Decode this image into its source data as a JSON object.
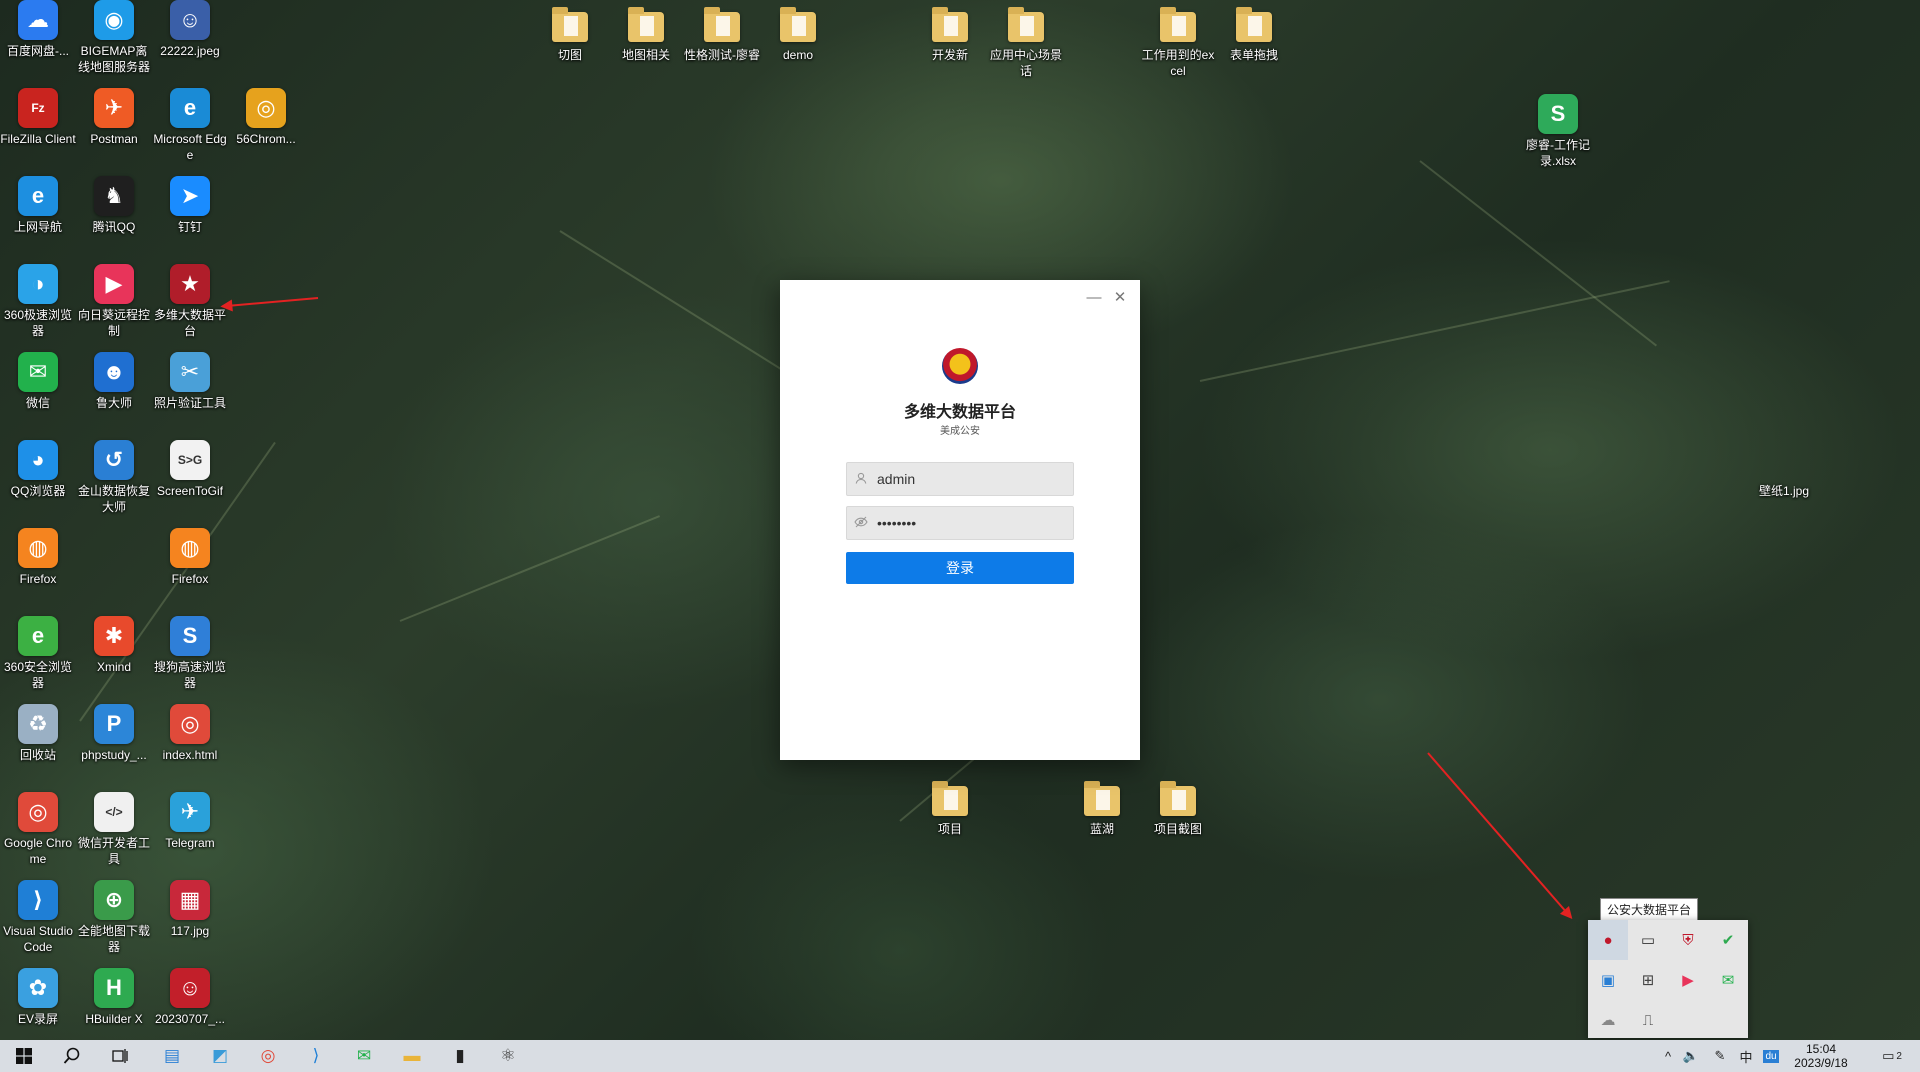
{
  "desktop": {
    "icons": [
      {
        "label": "百度网盘-...",
        "glyph": "☁",
        "color": "#2b7bf0"
      },
      {
        "label": "BIGEMAP离线地图服务器",
        "glyph": "◉",
        "color": "#1e9be8"
      },
      {
        "label": "22222.jpeg",
        "glyph": "☺",
        "color": "#3a5fa8"
      },
      {
        "label": "FileZilla Client",
        "glyph": "Fz",
        "color": "#c9241f"
      },
      {
        "label": "Postman",
        "glyph": "✈",
        "color": "#ef5b25"
      },
      {
        "label": "Microsoft Edge",
        "glyph": "e",
        "color": "#1a8bd6"
      },
      {
        "label": "56Chrom...",
        "glyph": "◎",
        "color": "#e6a21d"
      },
      {
        "label": "上网导航",
        "glyph": "e",
        "color": "#1d8fe0"
      },
      {
        "label": "腾讯QQ",
        "glyph": "♞",
        "color": "#1f1f1f"
      },
      {
        "label": "钉钉",
        "glyph": "➤",
        "color": "#1a8cff"
      },
      {
        "label": "360极速浏览器",
        "glyph": "◑",
        "color": "#2aa3e8"
      },
      {
        "label": "向日葵远程控制",
        "glyph": "▶",
        "color": "#e8345a"
      },
      {
        "label": "多维大数据平台",
        "glyph": "★",
        "color": "#b01d2a"
      },
      {
        "label": "微信",
        "glyph": "✉",
        "color": "#22b14c"
      },
      {
        "label": "鲁大师",
        "glyph": "☻",
        "color": "#1f6fd1"
      },
      {
        "label": "照片验证工具",
        "glyph": "✂",
        "color": "#4aa0d8"
      },
      {
        "label": "QQ浏览器",
        "glyph": "◕",
        "color": "#1e90e8"
      },
      {
        "label": "金山数据恢复大师",
        "glyph": "↺",
        "color": "#2a7fd4"
      },
      {
        "label": "ScreenToGif",
        "glyph": "S>G",
        "color": "#f2f2f2"
      },
      {
        "label": "Firefox",
        "glyph": "◍",
        "color": "#f5841f"
      },
      {
        "label": "Firefox",
        "glyph": "◍",
        "color": "#f5841f"
      },
      {
        "label": "360安全浏览器",
        "glyph": "e",
        "color": "#3cb043"
      },
      {
        "label": "Xmind",
        "glyph": "✱",
        "color": "#e84a2c"
      },
      {
        "label": "搜狗高速浏览器",
        "glyph": "S",
        "color": "#2f7fd8"
      },
      {
        "label": "回收站",
        "glyph": "♻",
        "color": "#9ab0c4"
      },
      {
        "label": "phpstudy_...",
        "glyph": "P",
        "color": "#2c86d8"
      },
      {
        "label": "index.html",
        "glyph": "◎",
        "color": "#e04a3a"
      },
      {
        "label": "Google Chrome",
        "glyph": "◎",
        "color": "#e04a3a"
      },
      {
        "label": "微信开发者工具",
        "glyph": "</>",
        "color": "#f0f0f0"
      },
      {
        "label": "Telegram",
        "glyph": "✈",
        "color": "#2aa1da"
      },
      {
        "label": "Visual Studio Code",
        "glyph": "⟩",
        "color": "#1f7fd6"
      },
      {
        "label": "全能地图下载器",
        "glyph": "⊕",
        "color": "#3a9b4a"
      },
      {
        "label": "117.jpg",
        "glyph": "▦",
        "color": "#c8283a"
      },
      {
        "label": "EV录屏",
        "glyph": "✿",
        "color": "#3aa0e0"
      },
      {
        "label": "HBuilder X",
        "glyph": "H",
        "color": "#2eaa50"
      },
      {
        "label": "20230707_...",
        "glyph": "☺",
        "color": "#c21f2a"
      }
    ],
    "folders": [
      {
        "label": "切图"
      },
      {
        "label": "地图相关"
      },
      {
        "label": "性格测试-廖睿"
      },
      {
        "label": "demo"
      },
      {
        "label": "开发新"
      },
      {
        "label": "应用中心场景话"
      },
      {
        "label": "工作用到的excel"
      },
      {
        "label": "表单拖拽"
      },
      {
        "label": "项目"
      },
      {
        "label": "蓝湖"
      },
      {
        "label": "项目截图"
      }
    ],
    "files": [
      {
        "label": "廖睿-工作记录.xlsx",
        "glyph": "S",
        "color": "#2eaa5a"
      },
      {
        "label": "壁纸1.jpg",
        "glyph": "",
        "color": "transparent"
      }
    ]
  },
  "login": {
    "minimize": "—",
    "close": "✕",
    "title": "多维大数据平台",
    "subtitle": "美成公安",
    "username_value": "admin",
    "password_value": "••••••••",
    "user_icon": "user-icon",
    "lock_icon": "eye-off-icon",
    "submit_label": "登录"
  },
  "tray": {
    "tooltip": "公安大数据平台",
    "icons": [
      {
        "name": "police-app-tray-icon",
        "glyph": "●",
        "color": "#c0182b"
      },
      {
        "name": "monitor-tray-icon",
        "glyph": "▭",
        "color": "#333"
      },
      {
        "name": "shield-tray-icon",
        "glyph": "⛨",
        "color": "#c0182b"
      },
      {
        "name": "check-tray-icon",
        "glyph": "✔",
        "color": "#2eaa50"
      },
      {
        "name": "screenshot-tray-icon",
        "glyph": "▣",
        "color": "#2a7fd4"
      },
      {
        "name": "windows-tray-icon",
        "glyph": "⊞",
        "color": "#444"
      },
      {
        "name": "sunflower-tray-icon",
        "glyph": "▶",
        "color": "#e8345a"
      },
      {
        "name": "wechat-tray-icon",
        "glyph": "✉",
        "color": "#22b14c"
      },
      {
        "name": "cloud-tray-icon",
        "glyph": "☁",
        "color": "#888"
      },
      {
        "name": "usb-tray-icon",
        "glyph": "⎍",
        "color": "#333"
      }
    ]
  },
  "taskbar": {
    "start": "⊞",
    "search": "⚲",
    "taskview": "⧉",
    "apps": [
      {
        "name": "desktop-app-icon",
        "glyph": "▤",
        "color": "#2a7fd4"
      },
      {
        "name": "notes-app-icon",
        "glyph": "◩",
        "color": "#3a9bd8"
      },
      {
        "name": "chrome-app-icon",
        "glyph": "◎",
        "color": "#e04a3a"
      },
      {
        "name": "vscode-app-icon",
        "glyph": "⟩",
        "color": "#1f7fd6"
      },
      {
        "name": "wechat-app-icon",
        "glyph": "✉",
        "color": "#22b14c"
      },
      {
        "name": "explorer-app-icon",
        "glyph": "▬",
        "color": "#e9b43a"
      },
      {
        "name": "terminal-app-icon",
        "glyph": "▮",
        "color": "#222"
      },
      {
        "name": "electron-app-icon",
        "glyph": "⚛",
        "color": "#333"
      }
    ],
    "tray_chevron": "^",
    "volume": "🔈",
    "pen": "✎",
    "ime": "中",
    "du": "du",
    "time": "15:04",
    "date": "2023/9/18",
    "notifications": "2"
  }
}
